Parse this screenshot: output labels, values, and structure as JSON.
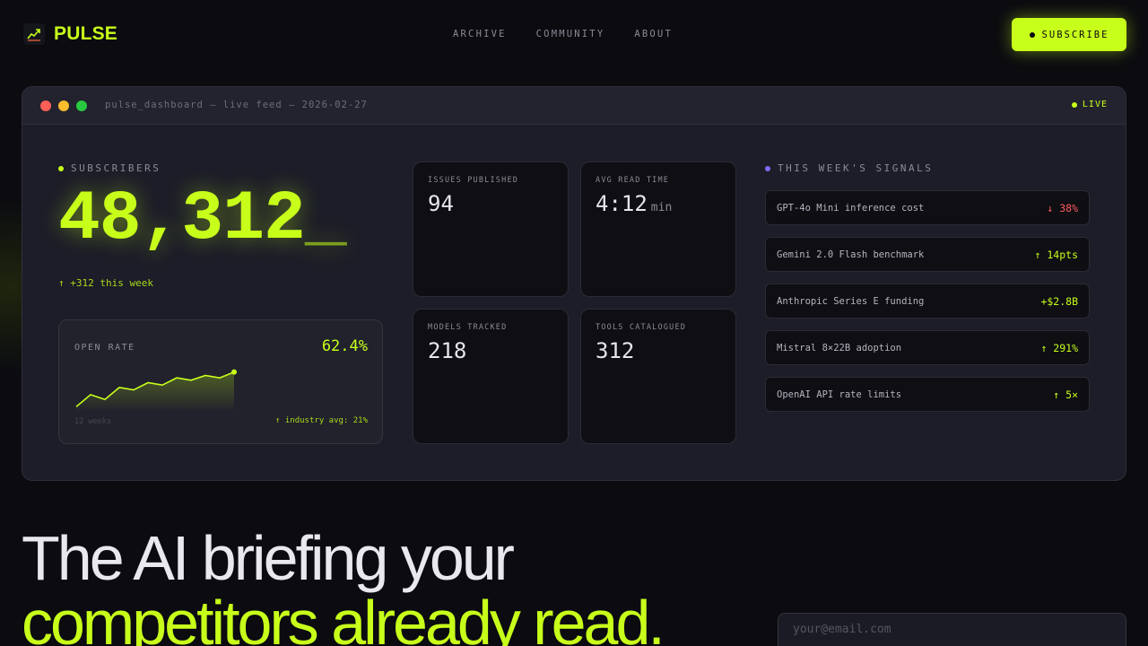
{
  "brand": {
    "name": "PULSE",
    "accent": "#c8ff1a",
    "logo_icon": "trend-chart-icon"
  },
  "nav": {
    "links": [
      "ARCHIVE",
      "COMMUNITY",
      "ABOUT"
    ],
    "cta": "SUBSCRIBE"
  },
  "window": {
    "title": "pulse_dashboard — live feed — 2026-02-27",
    "live": "LIVE",
    "traffic_colors": [
      "#ff5f57",
      "#febc2e",
      "#28c840"
    ]
  },
  "subscribers": {
    "label": "SUBSCRIBERS",
    "value": "48,312",
    "cursor": "_",
    "growth": "↑ +312 this week"
  },
  "open_rate": {
    "label": "OPEN RATE",
    "value": "62.4%",
    "weeks_label": "12 weeks",
    "industry": "↑ industry avg: 21%",
    "trend": [
      48,
      53,
      51,
      56,
      55,
      58,
      57,
      60,
      59,
      61,
      60,
      62.4
    ]
  },
  "stats": [
    {
      "label": "ISSUES PUBLISHED",
      "value": "94",
      "unit": ""
    },
    {
      "label": "AVG READ TIME",
      "value": "4:12",
      "unit": "min"
    },
    {
      "label": "MODELS TRACKED",
      "value": "218",
      "unit": ""
    },
    {
      "label": "TOOLS CATALOGUED",
      "value": "312",
      "unit": ""
    }
  ],
  "signals": {
    "label": "THIS WEEK'S SIGNALS",
    "items": [
      {
        "name": "GPT-4o Mini inference cost",
        "value": "↓ 38%",
        "color": "#ff5c5c"
      },
      {
        "name": "Gemini 2.0 Flash benchmark",
        "value": "↑ 14pts",
        "color": "#c8ff1a"
      },
      {
        "name": "Anthropic Series E funding",
        "value": "+$2.8B",
        "color": "#c8ff1a"
      },
      {
        "name": "Mistral 8×22B adoption",
        "value": "↑ 291%",
        "color": "#c8ff1a"
      },
      {
        "name": "OpenAI API rate limits",
        "value": "↑ 5×",
        "color": "#c8ff1a"
      }
    ]
  },
  "hero": {
    "line1": "The AI briefing your",
    "line2": "competitors already read."
  },
  "email": {
    "placeholder": "your@email.com"
  }
}
